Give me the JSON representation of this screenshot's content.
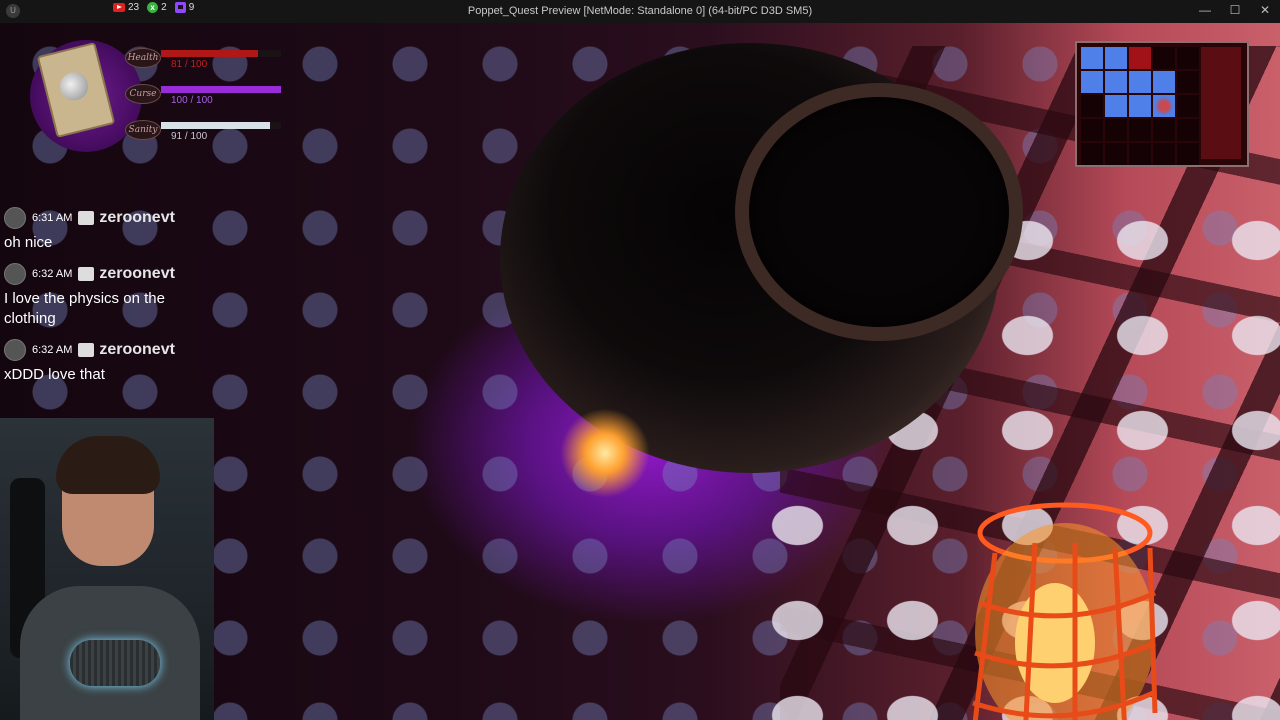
{
  "window": {
    "title": "Poppet_Quest Preview [NetMode: Standalone 0]  (64-bit/PC D3D SM5)",
    "controls": [
      "—",
      "☐",
      "✕"
    ]
  },
  "stream_counters": [
    {
      "icon": "youtube-icon",
      "count": "23"
    },
    {
      "icon": "xbox-icon",
      "count": "2"
    },
    {
      "icon": "twitch-icon",
      "count": "9"
    }
  ],
  "hud": {
    "stats": [
      {
        "label": "Health",
        "value": "81 / 100",
        "fill": 0.81,
        "color": "#b01818"
      },
      {
        "label": "Curse",
        "value": "100 / 100",
        "fill": 1.0,
        "color": "#9a2bd8"
      },
      {
        "label": "Sanity",
        "value": "91 / 100",
        "fill": 0.91,
        "color": "#d8e0e8"
      }
    ]
  },
  "chat": {
    "messages": [
      {
        "time": "6:31 AM",
        "user": "zeroonevt",
        "text": "oh nice"
      },
      {
        "time": "6:32 AM",
        "user": "zeroonevt",
        "text": "I love the physics on the clothing"
      },
      {
        "time": "6:32 AM",
        "user": "zeroonevt",
        "text": "xDDD love that"
      }
    ]
  },
  "minimap": {
    "colors": {
      "room": "#4f7fe8",
      "current": "#a01218",
      "empty": "#140204"
    },
    "rows": [
      [
        "room",
        "room",
        "current",
        "empty",
        "empty"
      ],
      [
        "room",
        "room",
        "room",
        "room",
        "empty"
      ],
      [
        "empty",
        "room",
        "room",
        "player",
        "empty"
      ],
      [
        "empty",
        "empty",
        "empty",
        "empty",
        "empty"
      ],
      [
        "empty",
        "empty",
        "empty",
        "empty",
        "empty"
      ]
    ]
  }
}
